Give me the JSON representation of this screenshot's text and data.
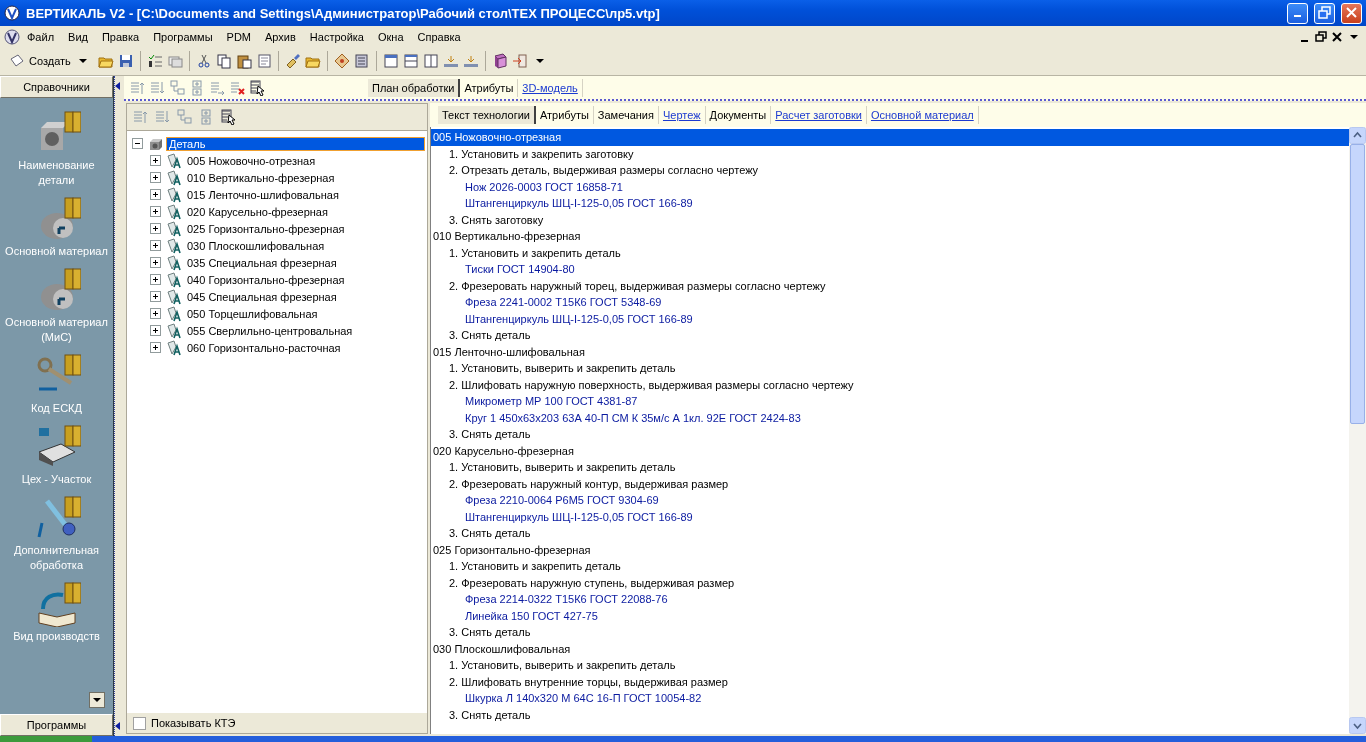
{
  "window": {
    "title": "ВЕРТИКАЛЬ V2 - [C:\\Documents and Settings\\Администратор\\Рабочий стол\\ТЕХ ПРОЦЕСС\\лр5.vtp]"
  },
  "menu": [
    "Файл",
    "Вид",
    "Правка",
    "Программы",
    "PDM",
    "Архив",
    "Настройка",
    "Окна",
    "Справка"
  ],
  "toolbar": {
    "create_button": "Создать"
  },
  "sidebar": {
    "header": "Справочники",
    "footer": "Программы",
    "items": [
      {
        "label": "Наименование детали"
      },
      {
        "label": "Основной материал"
      },
      {
        "label": "Основной материал (МиС)"
      },
      {
        "label": "Код ЕСКД"
      },
      {
        "label": "Цех - Участок"
      },
      {
        "label": "Дополнительная обработка"
      },
      {
        "label": "Вид производств"
      }
    ]
  },
  "top_tabs": [
    {
      "label": "План обработки",
      "kind": "tab",
      "selected": true
    },
    {
      "label": "Атрибуты",
      "kind": "tab",
      "selected": false
    },
    {
      "label": "3D-модель",
      "kind": "link",
      "selected": false
    }
  ],
  "tree": {
    "root": {
      "label": "Деталь",
      "selected": true,
      "expanded": true
    },
    "items": [
      {
        "label": "005 Ножовочно-отрезная",
        "expanded": false
      },
      {
        "label": "010 Вертикально-фрезерная",
        "expanded": false
      },
      {
        "label": "015 Ленточно-шлифовальная",
        "expanded": false
      },
      {
        "label": "020 Карусельно-фрезерная",
        "expanded": false
      },
      {
        "label": "025 Горизонтально-фрезерная",
        "expanded": false
      },
      {
        "label": "030 Плоскошлифовальная",
        "expanded": false
      },
      {
        "label": "035 Специальная фрезерная",
        "expanded": false
      },
      {
        "label": "040 Горизонтально-фрезерная",
        "expanded": false
      },
      {
        "label": "045 Специальная фрезерная",
        "expanded": false
      },
      {
        "label": "050 Торцешлифовальная",
        "expanded": false
      },
      {
        "label": "055 Сверлильно-центровальная",
        "expanded": false
      },
      {
        "label": "060 Горизонтально-расточная",
        "expanded": false
      }
    ]
  },
  "show_kte": {
    "label": "Показывать КТЭ",
    "checked": false
  },
  "detail_tabs": [
    {
      "label": "Текст технологии",
      "kind": "tab",
      "selected": true
    },
    {
      "label": "Атрибуты",
      "kind": "tab",
      "selected": false
    },
    {
      "label": "Замечания",
      "kind": "tab",
      "selected": false
    },
    {
      "label": "Чертеж",
      "kind": "link",
      "selected": false
    },
    {
      "label": "Документы",
      "kind": "tab",
      "selected": false
    },
    {
      "label": "Расчет заготовки",
      "kind": "link",
      "selected": false
    },
    {
      "label": "Основной материал",
      "kind": "link",
      "selected": false
    }
  ],
  "listing": [
    {
      "kind": "operation",
      "text": "005 Ножовочно-отрезная",
      "selected": true
    },
    {
      "kind": "step",
      "text": "1. Установить и закрепить заготовку",
      "selected": false
    },
    {
      "kind": "step",
      "text": "2. Отрезать деталь, выдерживая размеры согласно чертежу",
      "selected": false
    },
    {
      "kind": "tool",
      "text": "Нож 2026-0003   ГОСТ 16858-71",
      "selected": false
    },
    {
      "kind": "tool",
      "text": "Штангенциркуль ШЦ-I-125-0,05 ГОСТ 166-89",
      "selected": false
    },
    {
      "kind": "step",
      "text": "3. Снять заготовку",
      "selected": false
    },
    {
      "kind": "operation",
      "text": "010 Вертикально-фрезерная",
      "selected": false
    },
    {
      "kind": "step",
      "text": "1. Установить и закрепить деталь",
      "selected": false
    },
    {
      "kind": "tool",
      "text": "Тиски   ГОСТ 14904-80",
      "selected": false
    },
    {
      "kind": "step",
      "text": "2. Фрезеровать наружный торец, выдерживая размеры согласно чертежу",
      "selected": false
    },
    {
      "kind": "tool",
      "text": "Фреза 2241-0002 Т15К6 ГОСТ 5348-69",
      "selected": false
    },
    {
      "kind": "tool",
      "text": "Штангенциркуль ШЦ-I-125-0,05 ГОСТ 166-89",
      "selected": false
    },
    {
      "kind": "step",
      "text": "3. Снять деталь",
      "selected": false
    },
    {
      "kind": "operation",
      "text": "015 Ленточно-шлифовальная",
      "selected": false
    },
    {
      "kind": "step",
      "text": "1. Установить, выверить и закрепить деталь",
      "selected": false
    },
    {
      "kind": "step",
      "text": "2. Шлифовать наружную поверхность, выдерживая размеры согласно чертежу",
      "selected": false
    },
    {
      "kind": "tool",
      "text": "Микрометр МР 100 ГОСТ 4381-87",
      "selected": false
    },
    {
      "kind": "tool",
      "text": "Круг 1 450x63x203 63А 40-П СМ К 35м/с А 1кл. 92Е ГОСТ 2424-83",
      "selected": false
    },
    {
      "kind": "step",
      "text": "3. Снять деталь",
      "selected": false
    },
    {
      "kind": "operation",
      "text": "020 Карусельно-фрезерная",
      "selected": false
    },
    {
      "kind": "step",
      "text": "1. Установить, выверить и закрепить деталь",
      "selected": false
    },
    {
      "kind": "step",
      "text": "2. Фрезеровать наружный контур, выдерживая размер",
      "selected": false
    },
    {
      "kind": "tool",
      "text": "Фреза 2210-0064 Р6М5 ГОСТ 9304-69",
      "selected": false
    },
    {
      "kind": "tool",
      "text": "Штангенциркуль ШЦ-I-125-0,05 ГОСТ 166-89",
      "selected": false
    },
    {
      "kind": "step",
      "text": "3. Снять деталь",
      "selected": false
    },
    {
      "kind": "operation",
      "text": "025 Горизонтально-фрезерная",
      "selected": false
    },
    {
      "kind": "step",
      "text": "1. Установить и закрепить деталь",
      "selected": false
    },
    {
      "kind": "step",
      "text": "2. Фрезеровать наружную ступень, выдерживая размер",
      "selected": false
    },
    {
      "kind": "tool",
      "text": "Фреза 2214-0322 Т15К6 ГОСТ 22088-76",
      "selected": false
    },
    {
      "kind": "tool",
      "text": "Линейка 150 ГОСТ 427-75",
      "selected": false
    },
    {
      "kind": "step",
      "text": "3. Снять деталь",
      "selected": false
    },
    {
      "kind": "operation",
      "text": "030 Плоскошлифовальная",
      "selected": false
    },
    {
      "kind": "step",
      "text": "1. Установить, выверить и закрепить деталь",
      "selected": false
    },
    {
      "kind": "step",
      "text": "2. Шлифовать внутренние торцы, выдерживая размер",
      "selected": false
    },
    {
      "kind": "tool",
      "text": "Шкурка Л 140x320 М 64С 16-П   ГОСТ 10054-82",
      "selected": false
    },
    {
      "kind": "step",
      "text": "3. Снять деталь",
      "selected": false
    }
  ]
}
